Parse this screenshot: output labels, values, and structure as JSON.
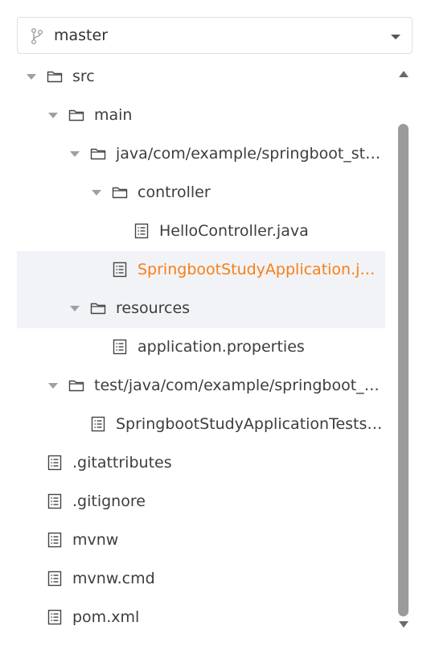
{
  "branch": {
    "name": "master",
    "icon": "git-branch-icon"
  },
  "tree": [
    {
      "label": "src",
      "type": "folder",
      "expanded": true,
      "depth": 0
    },
    {
      "label": "main",
      "type": "folder",
      "expanded": true,
      "depth": 1
    },
    {
      "label": "java/com/example/springboot_stu...",
      "type": "folder",
      "expanded": true,
      "depth": 2
    },
    {
      "label": "controller",
      "type": "folder",
      "expanded": true,
      "depth": 3
    },
    {
      "label": "HelloController.java",
      "type": "file",
      "depth": 4
    },
    {
      "label": "SpringbootStudyApplication.java",
      "type": "file",
      "depth": 3,
      "active": true
    },
    {
      "label": "resources",
      "type": "folder",
      "expanded": true,
      "depth": 2
    },
    {
      "label": "application.properties",
      "type": "file",
      "depth": 3
    },
    {
      "label": "test/java/com/example/springboot_s...",
      "type": "folder",
      "expanded": true,
      "depth": 1
    },
    {
      "label": "SpringbootStudyApplicationTests.j...",
      "type": "file",
      "depth": 2
    },
    {
      "label": ".gitattributes",
      "type": "file",
      "depth": 0
    },
    {
      "label": ".gitignore",
      "type": "file",
      "depth": 0
    },
    {
      "label": "mvnw",
      "type": "file",
      "depth": 0
    },
    {
      "label": "mvnw.cmd",
      "type": "file",
      "depth": 0
    },
    {
      "label": "pom.xml",
      "type": "file",
      "depth": 0
    }
  ],
  "colors": {
    "active_file": "#f77f17",
    "text": "#3d3d3d",
    "selected_bg": "#f1f3f6"
  }
}
